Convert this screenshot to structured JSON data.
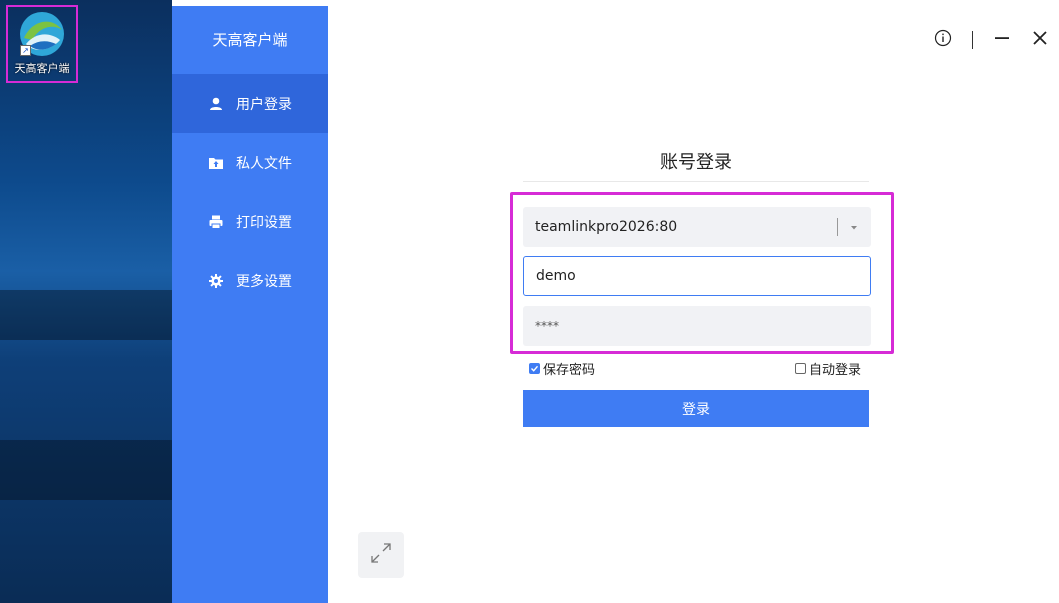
{
  "desktop": {
    "icon_label": "天高客户端"
  },
  "app": {
    "title": "天高客户端",
    "nav": [
      {
        "label": "用户登录",
        "icon": "user-icon",
        "active": true
      },
      {
        "label": "私人文件",
        "icon": "folder-upload-icon",
        "active": false
      },
      {
        "label": "打印设置",
        "icon": "printer-icon",
        "active": false
      },
      {
        "label": "更多设置",
        "icon": "gear-icon",
        "active": false
      }
    ],
    "window_controls": [
      "info-icon",
      "minimize-icon",
      "close-icon"
    ]
  },
  "login": {
    "title": "账号登录",
    "server_value": "teamlinkpro2026:80",
    "username_value": "demo",
    "password_value": "****",
    "save_password_label": "保存密码",
    "save_password_checked": true,
    "auto_login_label": "自动登录",
    "auto_login_checked": false,
    "submit_label": "登录"
  },
  "colors": {
    "accent": "#3f7cf3",
    "highlight": "#d62bd6"
  }
}
